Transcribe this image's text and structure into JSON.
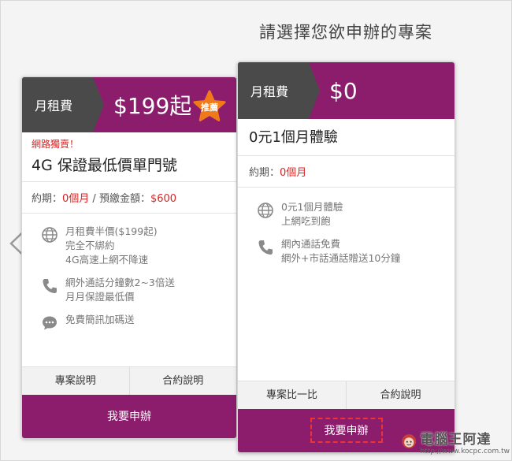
{
  "heading": "請選擇您欲申辦的專案",
  "cards": [
    {
      "fee_label": "月租費",
      "price": "$199起",
      "badge": "推薦",
      "promo": "網路獨賣！",
      "plan_name": "4G 保證最低價單門號",
      "terms": {
        "period_label": "約期：",
        "period_value": "0個月",
        "separator": " / ",
        "prepay_label": "預繳金額：",
        "prepay_value": "$600"
      },
      "features": [
        {
          "icon": "globe-icon",
          "lines": [
            "月租費半價($199起)",
            "完全不綁約",
            "4G高速上網不降速"
          ]
        },
        {
          "icon": "phone-icon",
          "lines": [
            "網外通話分鐘數2~3倍送",
            "月月保證最低價"
          ]
        },
        {
          "icon": "chat-bubble-icon",
          "lines": [
            "免費簡訊加碼送"
          ]
        }
      ],
      "buttons": [
        "專案說明",
        "合約說明"
      ],
      "apply": "我要申辦"
    },
    {
      "fee_label": "月租費",
      "price": "$0",
      "plan_name": "0元1個月體驗",
      "terms": {
        "period_label": "約期：",
        "period_value": "0個月"
      },
      "features": [
        {
          "icon": "globe-icon",
          "lines": [
            "0元1個月體驗",
            "上網吃到飽"
          ]
        },
        {
          "icon": "phone-icon",
          "lines": [
            "網內通話免費",
            "網外+市話通話贈送10分鐘"
          ]
        }
      ],
      "buttons": [
        "專案比一比",
        "合約說明"
      ],
      "apply": "我要申辦"
    }
  ],
  "watermark": {
    "title": "電腦王阿達",
    "url": "http://www.kocpc.com.tw"
  },
  "colors": {
    "brand": "#8c1d6c",
    "tab": "#4a4a4a",
    "badge": "#f07a1a",
    "alert": "#dd2222"
  }
}
